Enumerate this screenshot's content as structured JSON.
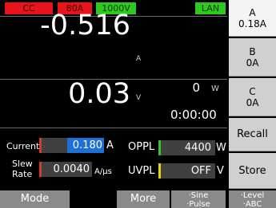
{
  "status": {
    "mode_badge": "CC",
    "range_badge": "80A",
    "voltage_badge": "1000V",
    "interface_badge": "LAN"
  },
  "readout": {
    "current_value": "-0.516",
    "current_unit": "A",
    "voltage_value": "0.03",
    "voltage_unit": "V",
    "power_value": "0",
    "power_unit": "W",
    "elapsed_time": "0:00:00"
  },
  "settings": {
    "current_label": "Current",
    "current_value": "0.180",
    "current_unit": "A",
    "slew_label_1": "Slew",
    "slew_label_2": "Rate",
    "slew_value": "0.0040",
    "slew_unit": "A/µs",
    "oppl_label": "OPPL",
    "oppl_value": "4400",
    "oppl_unit": "W",
    "uvpl_label": "UVPL",
    "uvpl_value": "OFF",
    "uvpl_unit": "V"
  },
  "side_buttons": {
    "a_label": "A",
    "a_value": "0.18A",
    "b_label": "B",
    "b_value": "0A",
    "c_label": "C",
    "c_value": "0A",
    "recall": "Recall",
    "store": "Store"
  },
  "bottom_buttons": {
    "mode": "Mode",
    "more": "More",
    "sine_1": "·Sine",
    "sine_2": "·Pulse",
    "level_1": "·Level",
    "level_2": "·ABC"
  },
  "colors": {
    "alarm_red": "#e8131b",
    "ok_green": "#2ec81f",
    "edit_blue": "#1e6fd6",
    "button_gray": "#8a8a8a"
  }
}
